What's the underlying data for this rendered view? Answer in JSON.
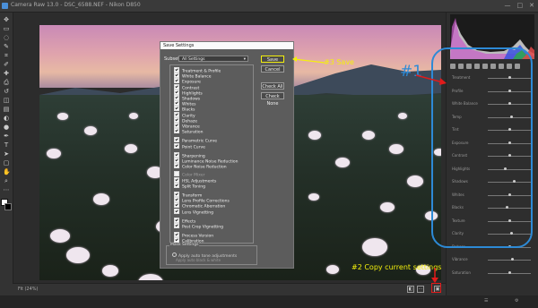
{
  "window": {
    "title": "Camera Raw 13.0  -  DSC_6588.NEF  -  Nikon D850",
    "controls": [
      "—",
      "□",
      "✕"
    ]
  },
  "toolbar": {
    "tools": [
      "move-tool-icon",
      "marquee-tool-icon",
      "lasso-tool-icon",
      "brush-tool-icon",
      "crop-tool-icon",
      "eyedropper-tool-icon",
      "heal-tool-icon",
      "stamp-tool-icon",
      "history-brush-icon",
      "eraser-tool-icon",
      "gradient-tool-icon",
      "blur-tool-icon",
      "dodge-tool-icon",
      "pen-tool-icon",
      "type-tool-icon",
      "path-select-icon",
      "shape-tool-icon",
      "hand-tool-icon",
      "zoom-tool-icon",
      "more-tools-icon"
    ]
  },
  "dialog": {
    "title": "Save Settings",
    "subset_label": "Subset:",
    "subset_value": "All Settings",
    "items": [
      {
        "label": "Treatment & Profile",
        "checked": true
      },
      {
        "label": "White Balance",
        "checked": true
      },
      {
        "label": "Exposure",
        "checked": true
      },
      {
        "label": "Contrast",
        "checked": true
      },
      {
        "label": "Highlights",
        "checked": true
      },
      {
        "label": "Shadows",
        "checked": true
      },
      {
        "label": "Whites",
        "checked": true
      },
      {
        "label": "Blacks",
        "checked": true
      },
      {
        "label": "Clarity",
        "checked": true
      },
      {
        "label": "Dehaze",
        "checked": true
      },
      {
        "label": "Vibrance",
        "checked": true
      },
      {
        "label": "Saturation",
        "checked": true
      },
      {
        "label": "Parametric Curve",
        "checked": true
      },
      {
        "label": "Point Curve",
        "checked": true
      },
      {
        "label": "Sharpening",
        "checked": true
      },
      {
        "label": "Luminance Noise Reduction",
        "checked": true
      },
      {
        "label": "Color Noise Reduction",
        "checked": true
      },
      {
        "label": "Color Mixer",
        "checked": false
      },
      {
        "label": "HSL Adjustments",
        "checked": true
      },
      {
        "label": "Split Toning",
        "checked": true
      },
      {
        "label": "Transform",
        "checked": true
      },
      {
        "label": "Lens Profile Corrections",
        "checked": true
      },
      {
        "label": "Chromatic Aberration",
        "checked": true
      },
      {
        "label": "Lens Vignetting",
        "checked": true
      },
      {
        "label": "Effects",
        "checked": true
      },
      {
        "label": "Post Crop Vignetting",
        "checked": true
      },
      {
        "label": "Process Version",
        "checked": true
      },
      {
        "label": "Calibration",
        "checked": true
      }
    ],
    "buttons": {
      "save": "Save",
      "cancel": "Cancel",
      "check_all": "Check All",
      "check_none": "Check None"
    },
    "bottom_group_label": "Mask Settings",
    "bottom_option": "Apply auto tone adjustments",
    "bottom_option2": "Apply auto black & white"
  },
  "annotations": {
    "save": "#3 Save",
    "panel": "#1",
    "copy": "#2 Copy current settings"
  },
  "right_panel": {
    "rows": [
      {
        "label": "Treatment",
        "value": 0.5
      },
      {
        "label": "Profile",
        "value": 0.5
      },
      {
        "label": "White Balance",
        "value": 0.5
      },
      {
        "label": "Temp",
        "value": 0.55
      },
      {
        "label": "Tint",
        "value": 0.5
      },
      {
        "label": "Exposure",
        "value": 0.5
      },
      {
        "label": "Contrast",
        "value": 0.52
      },
      {
        "label": "Highlights",
        "value": 0.4
      },
      {
        "label": "Shadows",
        "value": 0.62
      },
      {
        "label": "Whites",
        "value": 0.5
      },
      {
        "label": "Blacks",
        "value": 0.45
      },
      {
        "label": "Texture",
        "value": 0.5
      },
      {
        "label": "Clarity",
        "value": 0.55
      },
      {
        "label": "Dehaze",
        "value": 0.5
      },
      {
        "label": "Vibrance",
        "value": 0.58
      },
      {
        "label": "Saturation",
        "value": 0.5
      }
    ]
  },
  "status": {
    "zoom": "Fit (24%)"
  },
  "colors": {
    "annotation_yellow": "#f4f00c",
    "annotation_blue": "#2d8ad6",
    "highlight_red": "#e11b1b"
  }
}
